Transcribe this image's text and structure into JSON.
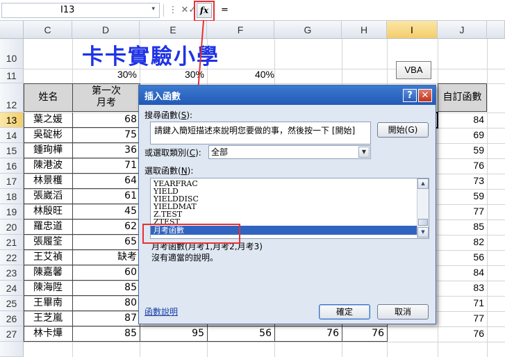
{
  "formula_bar": {
    "name_box": "I13",
    "name_box_dropdown": "▾",
    "cancel_glyph": "✕",
    "enter_glyph": "✓",
    "fx_label": "fx",
    "equals": "="
  },
  "columns": [
    "C",
    "D",
    "E",
    "F",
    "G",
    "H",
    "I",
    "J"
  ],
  "rows": [
    "10",
    "11",
    "12",
    "13",
    "14",
    "15",
    "16",
    "17",
    "18",
    "19",
    "20",
    "21",
    "22",
    "23",
    "24",
    "25",
    "26",
    "27"
  ],
  "sheet": {
    "title": "卡卡實驗小學",
    "percents": [
      "30%",
      "30%",
      "40%"
    ],
    "vba_button": "VBA",
    "header_name": "姓名",
    "header_first_line1": "第一次",
    "header_first_line2": "月考",
    "header_custom": "自訂函數",
    "students": [
      {
        "name": "葉之媛",
        "first": "68",
        "e": "",
        "f": "",
        "g": "",
        "h": "",
        "j": "84"
      },
      {
        "name": "吳碇彬",
        "first": "75",
        "e": "",
        "f": "",
        "g": "",
        "h": "",
        "j": "69"
      },
      {
        "name": "鍾珣樺",
        "first": "36",
        "e": "",
        "f": "",
        "g": "",
        "h": "",
        "j": "59"
      },
      {
        "name": "陳港波",
        "first": "71",
        "e": "",
        "f": "",
        "g": "",
        "h": "",
        "j": "76"
      },
      {
        "name": "林景穫",
        "first": "64",
        "e": "",
        "f": "",
        "g": "",
        "h": "",
        "j": "73"
      },
      {
        "name": "張崴滔",
        "first": "61",
        "e": "",
        "f": "",
        "g": "",
        "h": "",
        "j": "59"
      },
      {
        "name": "林殷旺",
        "first": "45",
        "e": "",
        "f": "",
        "g": "",
        "h": "",
        "j": "77"
      },
      {
        "name": "羅忠道",
        "first": "62",
        "e": "",
        "f": "",
        "g": "",
        "h": "",
        "j": "85"
      },
      {
        "name": "張履筌",
        "first": "65",
        "e": "",
        "f": "",
        "g": "",
        "h": "",
        "j": "82"
      },
      {
        "name": "王艾禎",
        "first": "缺考",
        "e": "",
        "f": "",
        "g": "",
        "h": "",
        "j": "56"
      },
      {
        "name": "陳嘉馨",
        "first": "60",
        "e": "",
        "f": "",
        "g": "",
        "h": "",
        "j": "84"
      },
      {
        "name": "陳海陞",
        "first": "85",
        "e": "",
        "f": "",
        "g": "",
        "h": "",
        "j": "83"
      },
      {
        "name": "王畢南",
        "first": "80",
        "e": "",
        "f": "",
        "g": "",
        "h": "",
        "j": "71"
      },
      {
        "name": "王芝嵐",
        "first": "87",
        "e": "",
        "f": "",
        "g": "",
        "h": "",
        "j": "77"
      },
      {
        "name": "林卡燁",
        "first": "85",
        "e": "95",
        "f": "56",
        "g": "76",
        "h": "76",
        "j": "76"
      }
    ]
  },
  "dialog": {
    "title": "插入函數",
    "help_glyph": "?",
    "close_glyph": "✕",
    "search_label": "搜尋函數(",
    "search_key": "S",
    "search_label_end": "):",
    "search_text": "請鍵入簡短描述來說明您要做的事，然後按一下 [開始]",
    "go_button": "開始(G)",
    "category_label": "或選取類別(",
    "category_key": "C",
    "category_label_end": "):",
    "category_value": "全部",
    "select_label": "選取函數(",
    "select_key": "N",
    "select_label_end": "):",
    "functions": [
      "YEARFRAC",
      "YIELD",
      "YIELDDISC",
      "YIELDMAT",
      "Z.TEST",
      "ZTEST",
      "月考函數"
    ],
    "selected_function": "月考函數",
    "signature": "月考函數(月考1,月考2,月考3)",
    "description": "沒有適當的說明。",
    "help_link": "函數說明",
    "ok_button": "確定",
    "cancel_button": "取消"
  },
  "colors": {
    "title_blue": "#1f33e6",
    "highlight_red": "#e53030",
    "dialog_title_blue": "#2359b6",
    "selection_blue": "#3064c0"
  }
}
